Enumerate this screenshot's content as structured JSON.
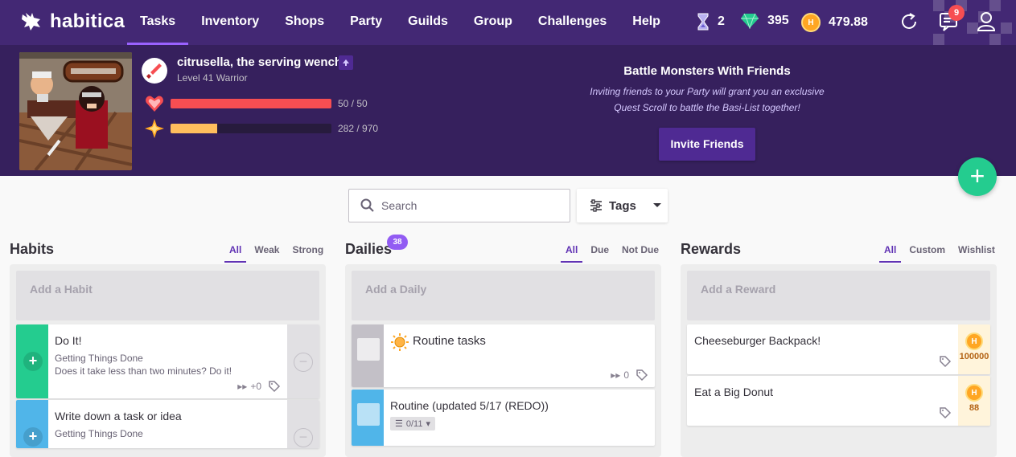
{
  "nav": {
    "logo_text": "habitica",
    "links": [
      "Tasks",
      "Inventory",
      "Shops",
      "Party",
      "Guilds",
      "Group",
      "Challenges",
      "Help"
    ],
    "active": "Tasks",
    "hourglasses": "2",
    "gems": "395",
    "gold": "479.88",
    "notifications": "9",
    "icons": [
      "hourglass-icon",
      "gem-icon",
      "gold-coin-icon",
      "sync-icon",
      "notifications-icon",
      "user-icon"
    ]
  },
  "hero": {
    "name": "citrusella, the serving wench",
    "level": "Level 41 Warrior",
    "health_text": "50 / 50",
    "health_fraction": 1.0,
    "exp_text": "282 / 970",
    "exp_fraction": 0.29,
    "class_icon": "sword-icon"
  },
  "promo": {
    "title": "Battle Monsters With Friends",
    "line1": "Inviting friends to your Party will grant you an exclusive",
    "line2": "Quest Scroll to battle the Basi-List together!",
    "button": "Invite Friends"
  },
  "toolbar": {
    "search_placeholder": "Search",
    "tags_label": "Tags"
  },
  "habits": {
    "title": "Habits",
    "filters": [
      "All",
      "Weak",
      "Strong"
    ],
    "add_placeholder": "Add a Habit",
    "items": [
      {
        "title": "Do It!",
        "notes1": "Getting Things Done",
        "notes2": "Does it take less than two minutes? Do it!",
        "counter": "+0"
      },
      {
        "title": "Write down a task or idea",
        "notes1": "Getting Things Done"
      }
    ]
  },
  "dailies": {
    "title": "Dailies",
    "badge": "38",
    "filters": [
      "All",
      "Due",
      "Not Due"
    ],
    "add_placeholder": "Add a Daily",
    "items": [
      {
        "title": "Routine tasks",
        "streak": "0"
      },
      {
        "title": "Routine (updated 5/17 (REDO))",
        "checklist": "0/11"
      }
    ]
  },
  "rewards": {
    "title": "Rewards",
    "filters": [
      "All",
      "Custom",
      "Wishlist"
    ],
    "add_placeholder": "Add a Reward",
    "items": [
      {
        "title": "Cheeseburger Backpack!",
        "price": "100000"
      },
      {
        "title": "Eat a Big Donut",
        "price": "88"
      }
    ]
  },
  "colors": {
    "nav_bg": "#432874",
    "header_bg": "#36205d",
    "health": "#f74e52",
    "exp": "#ffbe5d",
    "habit_green": "#24cc8f",
    "habit_teal": "#50b5e9",
    "daily_gray": "#c3c0c7",
    "daily_blue": "#50b5e9"
  }
}
